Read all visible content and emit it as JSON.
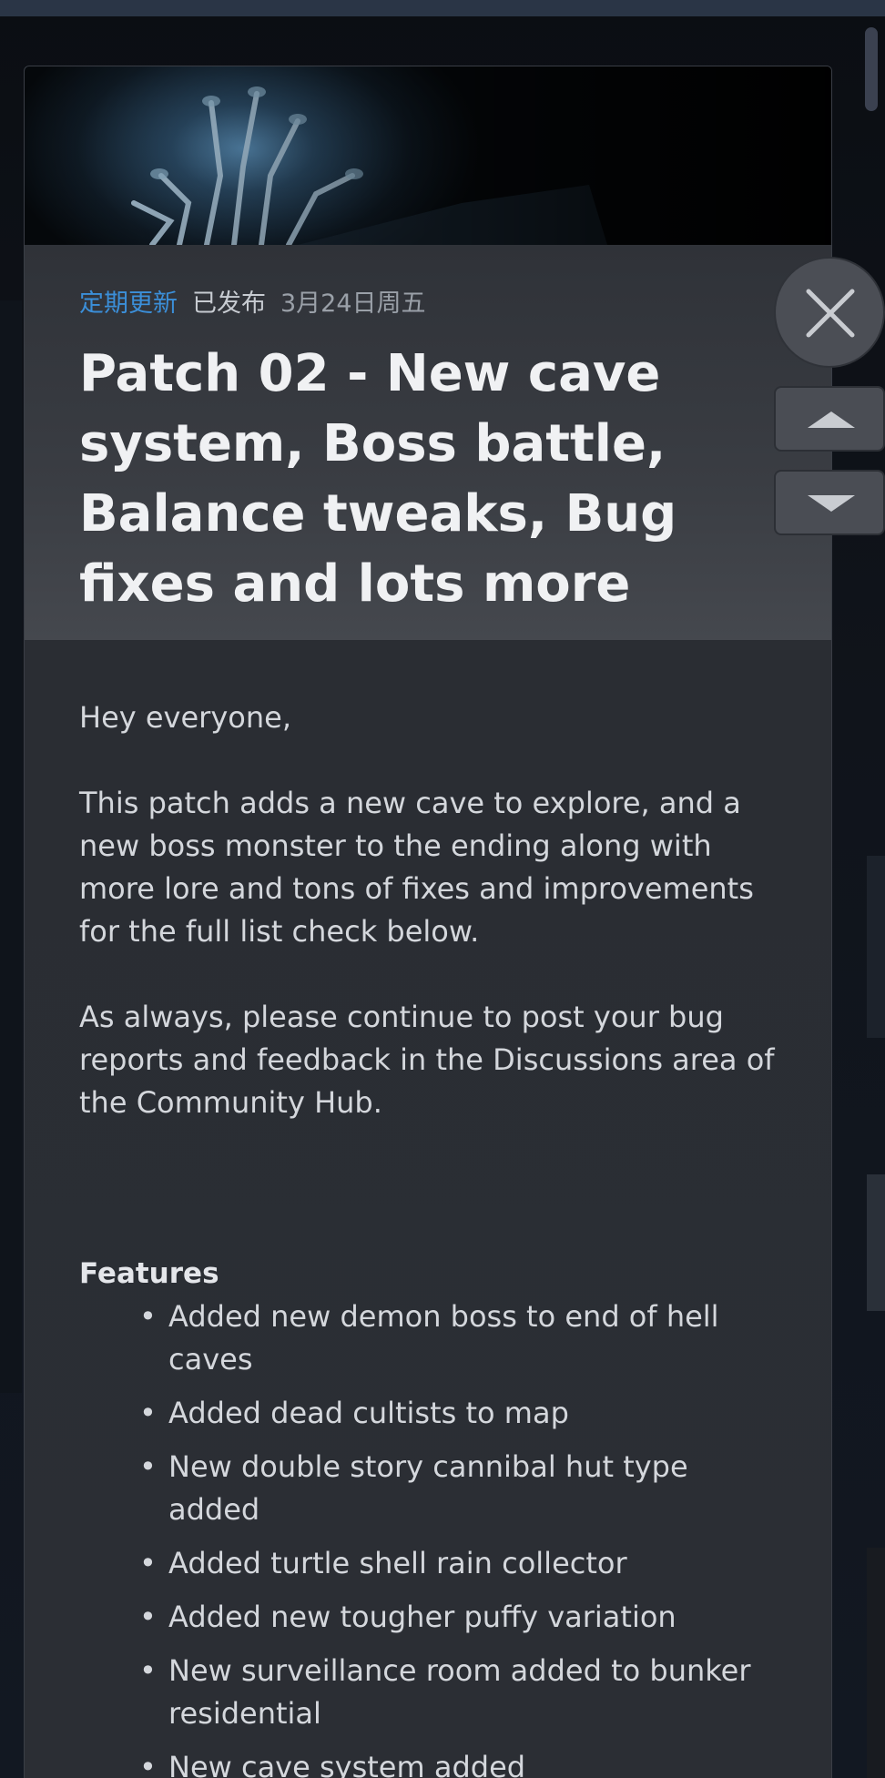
{
  "event": {
    "category": "定期更新",
    "published_label": "已发布",
    "date": "3月24日周五",
    "title": "Patch 02 - New cave system, Boss battle, Balance tweaks, Bug fixes and lots more"
  },
  "content": {
    "greeting": "Hey everyone,",
    "paragraph1": "This patch adds a new cave to explore, and a new boss monster to the ending along with more lore and tons of fixes and improvements for the full list check below.",
    "paragraph2": "As always, please continue to post your bug reports and feedback in the Discussions area of the Community Hub.",
    "features_heading": "Features",
    "features": [
      "Added new demon boss to end of hell caves",
      "Added dead cultists to map",
      "New double story cannibal hut type added",
      "Added turtle shell rain collector",
      "Added new tougher puffy variation",
      "New surveillance room added to bunker residential",
      "New cave system added"
    ]
  },
  "controls": {
    "close_icon": "close-icon",
    "up_icon": "chevron-up-icon",
    "down_icon": "chevron-down-icon"
  },
  "colors": {
    "accent": "#3b8fd9",
    "modal_bg": "#2a2d33",
    "text": "#d4d7dc"
  }
}
